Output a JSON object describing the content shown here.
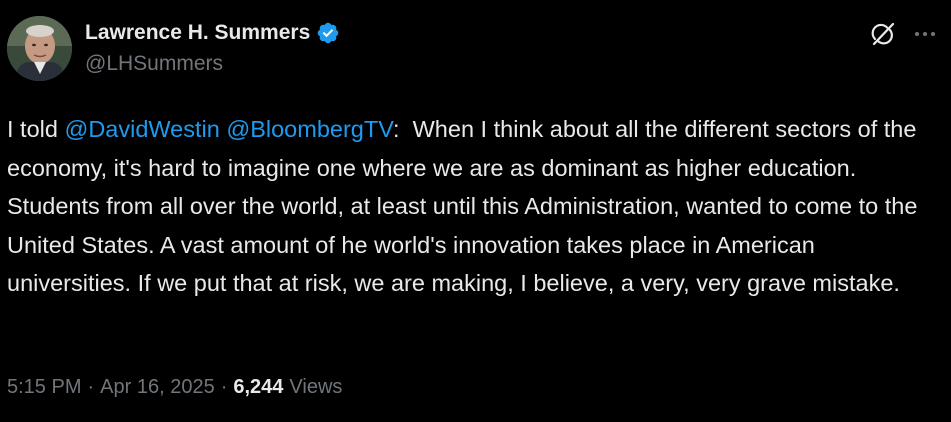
{
  "author": {
    "display_name": "Lawrence H. Summers",
    "handle": "@LHSummers",
    "verified_icon": "verified-badge-icon",
    "verified_color": "#1d9bf0"
  },
  "header_actions": {
    "grok_icon": "grok-icon",
    "more_icon": "more-options-icon"
  },
  "tweet": {
    "prefix": "I told ",
    "mention_1": "@DavidWestin",
    "space": " ",
    "mention_2": "@BloombergTV",
    "body": ":  When I think about all the different sectors of the economy, it's hard to imagine one where we are as dominant as higher education. Students from all over the world, at least until this Administration, wanted to come to the United States. A vast amount of he world's innovation takes place in American universities. If we put that at risk, we are making, I believe, a very, very grave mistake."
  },
  "meta": {
    "time": "5:15 PM",
    "separator": "·",
    "date": "Apr 16, 2025",
    "views_count": "6,244",
    "views_label": "Views"
  },
  "colors": {
    "background": "#000000",
    "text": "#e7e9ea",
    "secondary": "#71767b",
    "link": "#1d9bf0"
  }
}
